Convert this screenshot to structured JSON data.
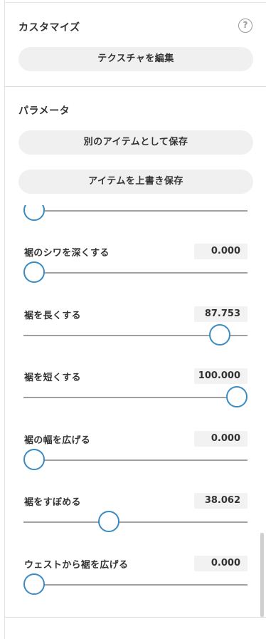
{
  "customize": {
    "title": "カスタマイズ",
    "help_icon": "question-circle-icon",
    "help_glyph": "?",
    "texture_button": "テクスチャを編集"
  },
  "parameters": {
    "title": "パラメータ",
    "save_as_new_button": "別のアイテムとして保存",
    "overwrite_button": "アイテムを上書き保存",
    "partial_slider_value_percent": 5,
    "items": [
      {
        "label": "裾のシワを深くする",
        "value": "0.000",
        "percent": 0
      },
      {
        "label": "裾を長くする",
        "value": "87.753",
        "percent": 87.753
      },
      {
        "label": "裾を短くする",
        "value": "100.000",
        "percent": 100
      },
      {
        "label": "裾の幅を広げる",
        "value": "0.000",
        "percent": 0
      },
      {
        "label": "裾をすぼめる",
        "value": "38.062",
        "percent": 38.062
      },
      {
        "label": "ウェストから裾を広げる",
        "value": "0.000",
        "percent": 0
      }
    ]
  },
  "colors": {
    "accent": "#3b8bc2",
    "track": "#a0a0a0",
    "button_bg": "#f0f0f0"
  }
}
